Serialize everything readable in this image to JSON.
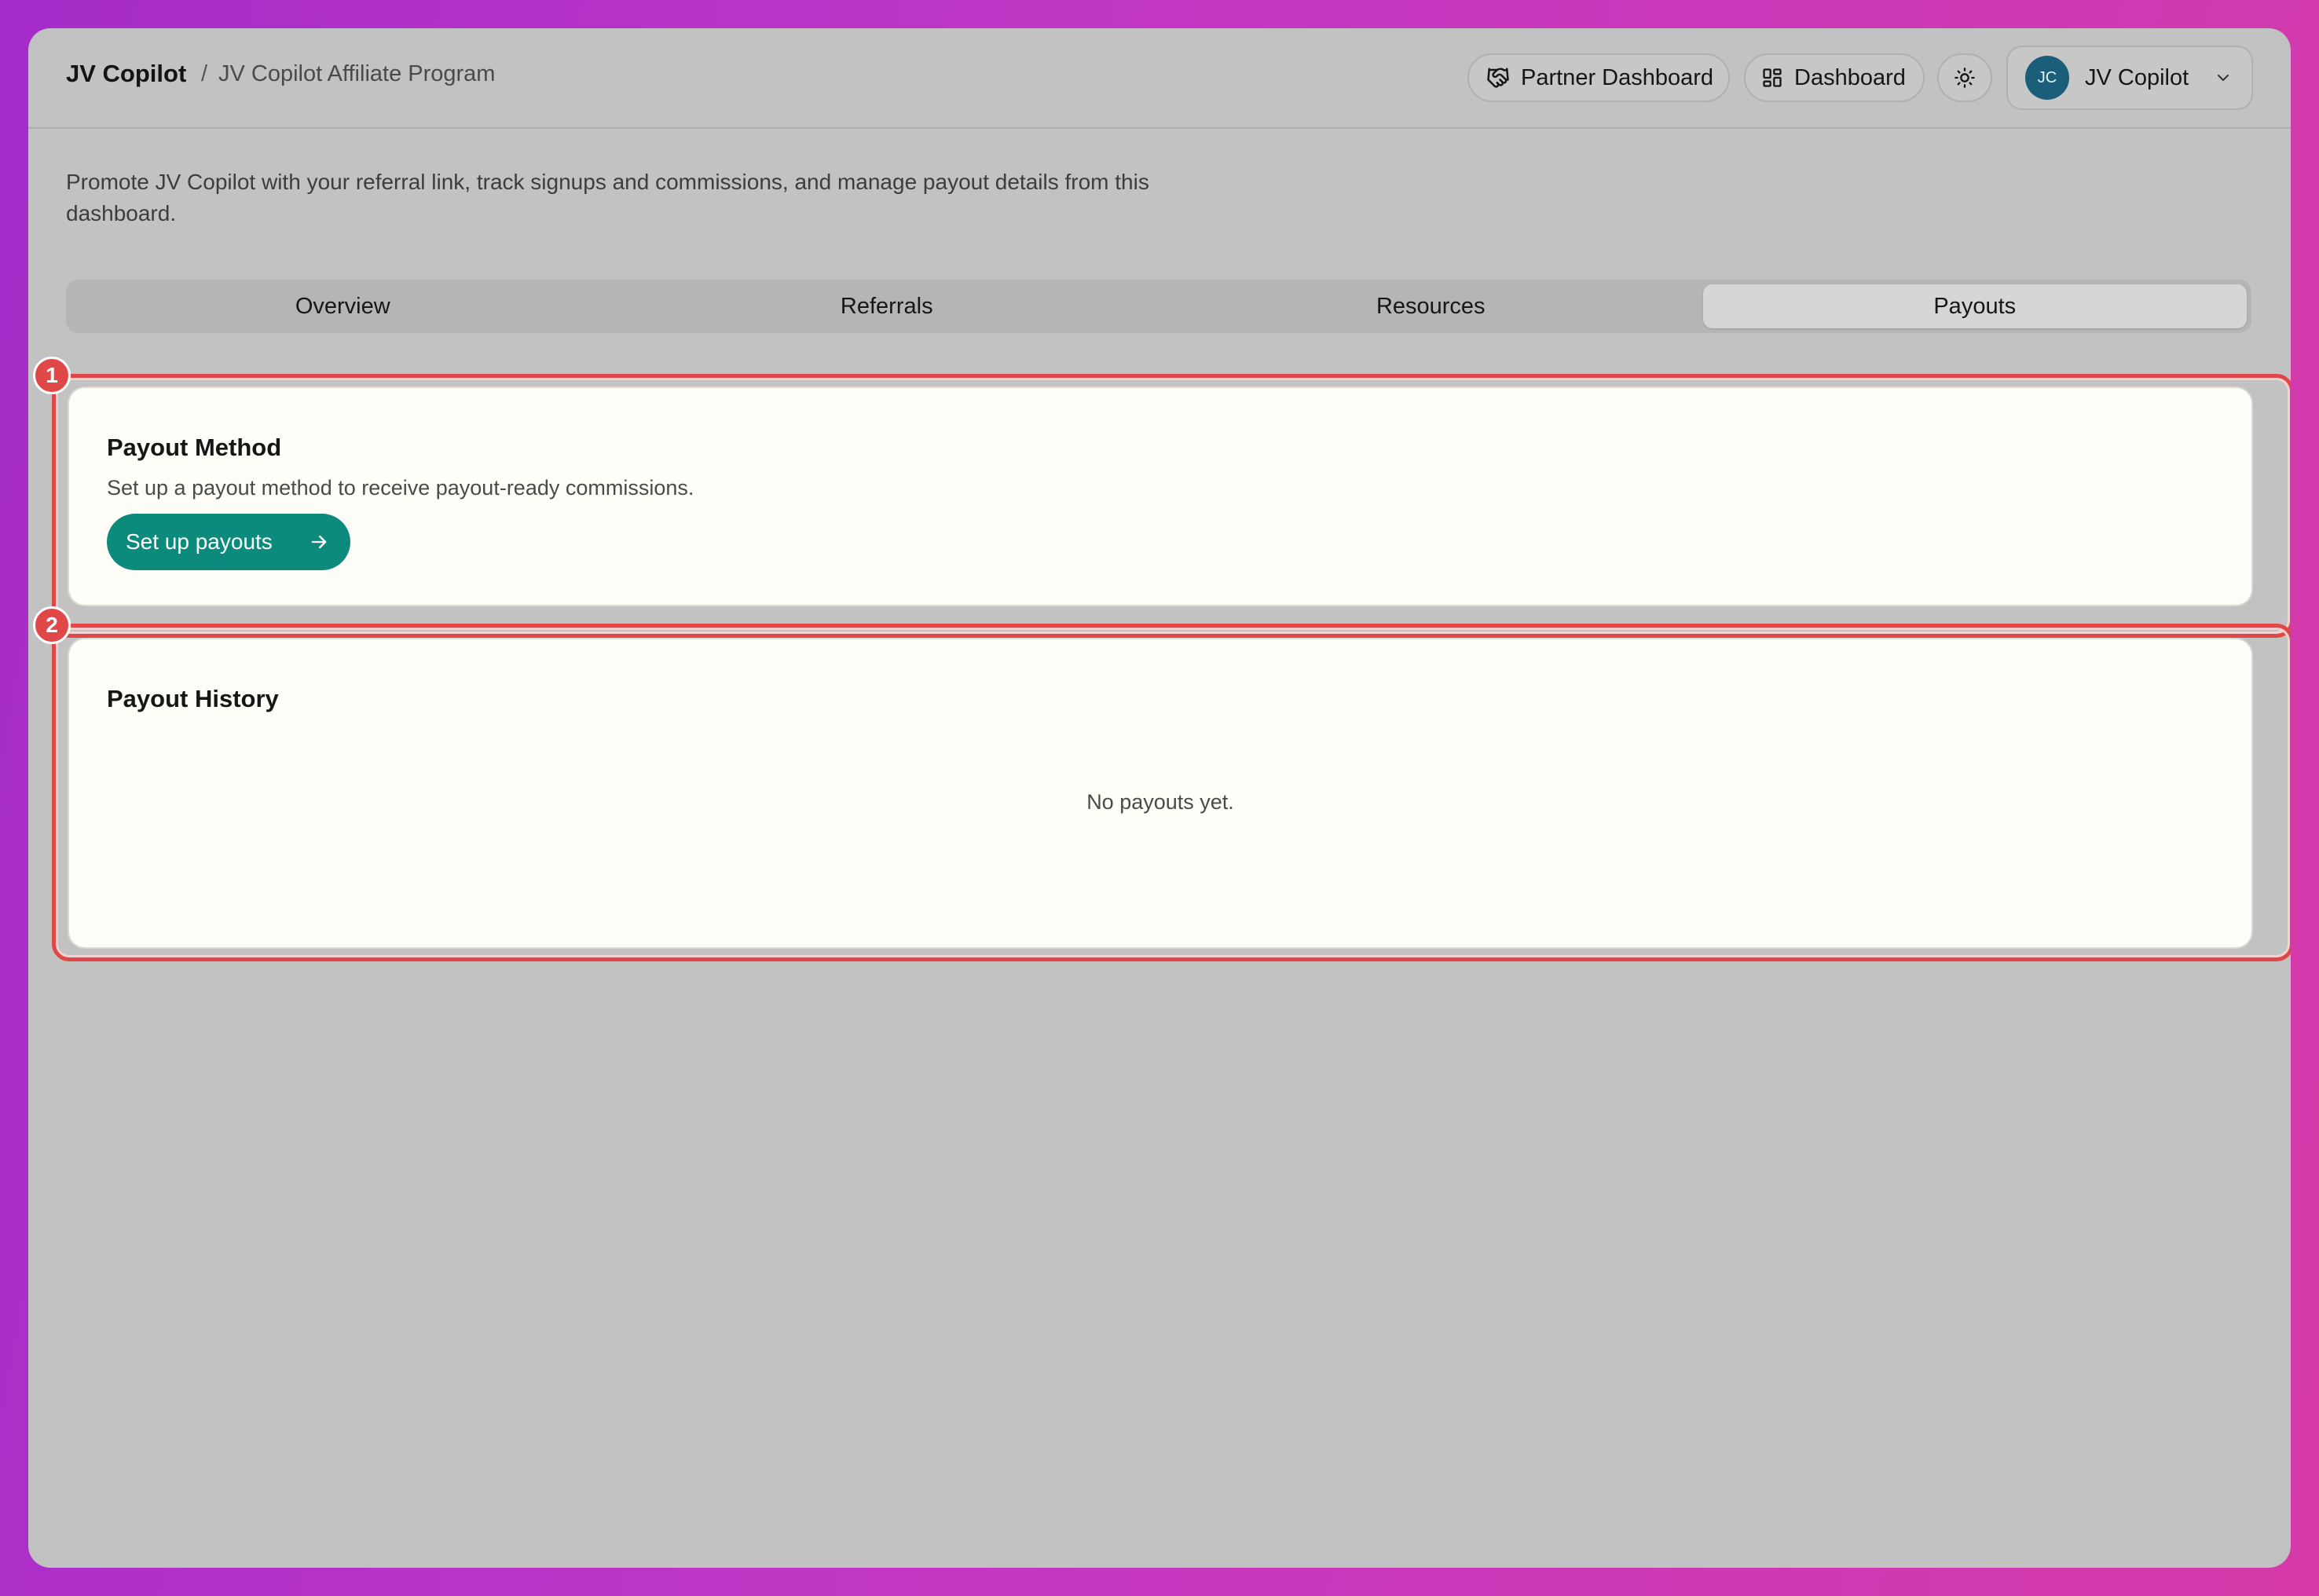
{
  "header": {
    "brand": "JV Copilot",
    "separator": "/",
    "breadcrumb": "JV Copilot Affiliate Program",
    "partner_dashboard_label": "Partner Dashboard",
    "dashboard_label": "Dashboard",
    "account": {
      "initials": "JC",
      "name": "JV Copilot"
    }
  },
  "intro": "Promote JV Copilot with your referral link, track signups and commissions, and manage payout details from this dashboard.",
  "tabs": [
    {
      "label": "Overview"
    },
    {
      "label": "Referrals"
    },
    {
      "label": "Resources"
    },
    {
      "label": "Payouts"
    }
  ],
  "active_tab": "Payouts",
  "payout_method": {
    "badge": "1",
    "title": "Payout Method",
    "description": "Set up a payout method to receive payout-ready commissions.",
    "button_label": "Set up payouts"
  },
  "payout_history": {
    "badge": "2",
    "title": "Payout History",
    "empty_message": "No payouts yet."
  },
  "colors": {
    "accent": "#0c8a7b",
    "highlight": "#e04848",
    "avatar": "#1b5e7a"
  },
  "icons": {
    "partner": "handshake-icon",
    "dashboard": "grid-icon",
    "theme": "sun-icon",
    "account_menu": "chevron-down-icon",
    "cta": "arrow-right-icon"
  }
}
